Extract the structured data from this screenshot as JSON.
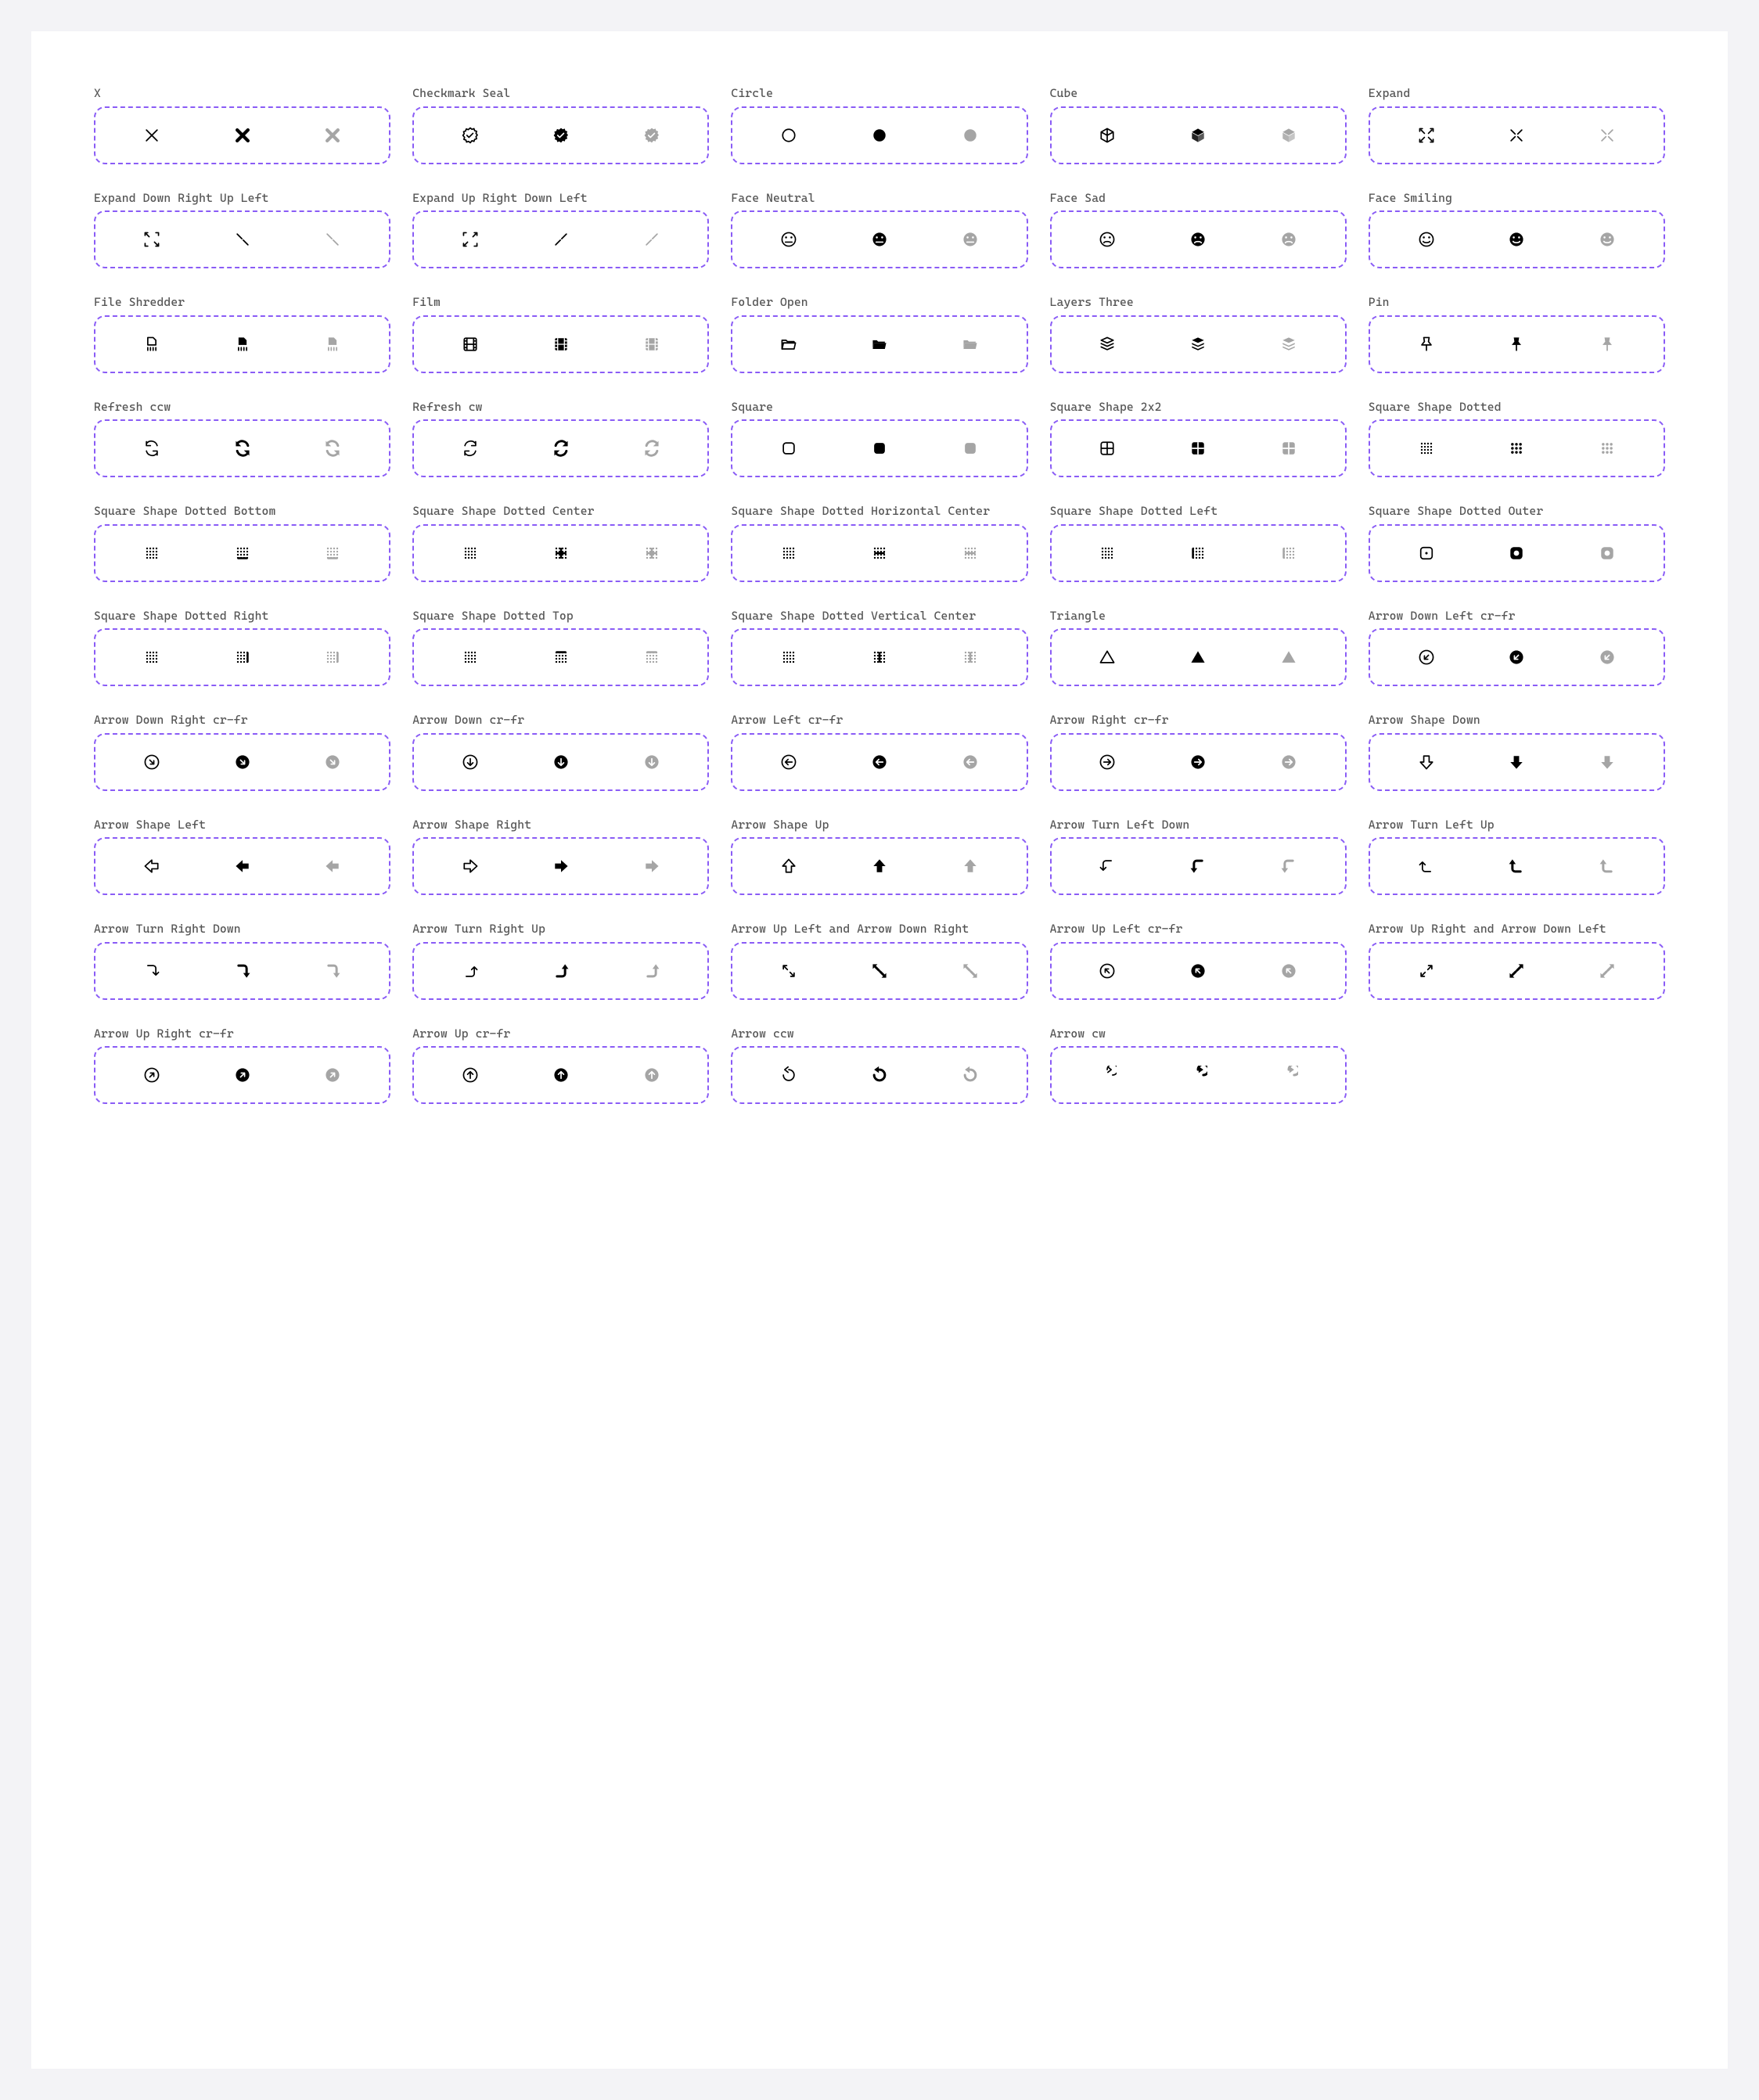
{
  "icons": [
    {
      "name": "X",
      "key": "x"
    },
    {
      "name": "Checkmark Seal",
      "key": "checkmark-seal"
    },
    {
      "name": "Circle",
      "key": "circle"
    },
    {
      "name": "Cube",
      "key": "cube"
    },
    {
      "name": "Expand",
      "key": "expand"
    },
    {
      "name": "Expand Down Right Up Left",
      "key": "expand-dr-ul"
    },
    {
      "name": "Expand Up Right Down Left",
      "key": "expand-ur-dl"
    },
    {
      "name": "Face Neutral",
      "key": "face-neutral"
    },
    {
      "name": "Face Sad",
      "key": "face-sad"
    },
    {
      "name": "Face Smiling",
      "key": "face-smiling"
    },
    {
      "name": "File Shredder",
      "key": "file-shredder"
    },
    {
      "name": "Film",
      "key": "film"
    },
    {
      "name": "Folder Open",
      "key": "folder-open"
    },
    {
      "name": "Layers Three",
      "key": "layers-three"
    },
    {
      "name": "Pin",
      "key": "pin"
    },
    {
      "name": "Refresh ccw",
      "key": "refresh-ccw"
    },
    {
      "name": "Refresh cw",
      "key": "refresh-cw"
    },
    {
      "name": "Square",
      "key": "square"
    },
    {
      "name": "Square Shape 2x2",
      "key": "square-2x2"
    },
    {
      "name": "Square Shape Dotted",
      "key": "square-dotted"
    },
    {
      "name": "Square Shape Dotted Bottom",
      "key": "sqd-bottom"
    },
    {
      "name": "Square Shape Dotted Center",
      "key": "sqd-center"
    },
    {
      "name": "Square Shape Dotted Horizontal Center",
      "key": "sqd-hcenter"
    },
    {
      "name": "Square Shape Dotted Left",
      "key": "sqd-left"
    },
    {
      "name": "Square Shape Dotted Outer",
      "key": "sqd-outer"
    },
    {
      "name": "Square Shape Dotted Right",
      "key": "sqd-right"
    },
    {
      "name": "Square Shape Dotted Top",
      "key": "sqd-top"
    },
    {
      "name": "Square Shape Dotted Vertical Center",
      "key": "sqd-vcenter"
    },
    {
      "name": "Triangle",
      "key": "triangle"
    },
    {
      "name": "Arrow Down Left cr-fr",
      "key": "arrow-dl-circ"
    },
    {
      "name": "Arrow Down Right cr-fr",
      "key": "arrow-dr-circ"
    },
    {
      "name": "Arrow Down cr-fr",
      "key": "arrow-d-circ"
    },
    {
      "name": "Arrow Left cr-fr",
      "key": "arrow-l-circ"
    },
    {
      "name": "Arrow Right cr-fr",
      "key": "arrow-r-circ"
    },
    {
      "name": "Arrow Shape Down",
      "key": "arrow-shape-d"
    },
    {
      "name": "Arrow Shape Left",
      "key": "arrow-shape-l"
    },
    {
      "name": "Arrow Shape Right",
      "key": "arrow-shape-r"
    },
    {
      "name": "Arrow Shape Up",
      "key": "arrow-shape-u"
    },
    {
      "name": "Arrow Turn Left Down",
      "key": "arrow-turn-ld"
    },
    {
      "name": "Arrow Turn Left Up",
      "key": "arrow-turn-lu"
    },
    {
      "name": "Arrow Turn Right Down",
      "key": "arrow-turn-rd"
    },
    {
      "name": "Arrow Turn Right Up",
      "key": "arrow-turn-ru"
    },
    {
      "name": "Arrow Up Left and Arrow Down Right",
      "key": "arrow-ul-dr"
    },
    {
      "name": "Arrow Up Left cr-fr",
      "key": "arrow-ul-circ"
    },
    {
      "name": "Arrow Up Right and Arrow Down Left",
      "key": "arrow-ur-dl"
    },
    {
      "name": "Arrow Up Right cr-fr",
      "key": "arrow-ur-circ"
    },
    {
      "name": "Arrow Up cr-fr",
      "key": "arrow-u-circ"
    },
    {
      "name": "Arrow ccw",
      "key": "arrow-ccw"
    },
    {
      "name": "Arrow cw",
      "key": "arrow-cw"
    }
  ],
  "variants": [
    "outline",
    "solid",
    "ghost"
  ]
}
